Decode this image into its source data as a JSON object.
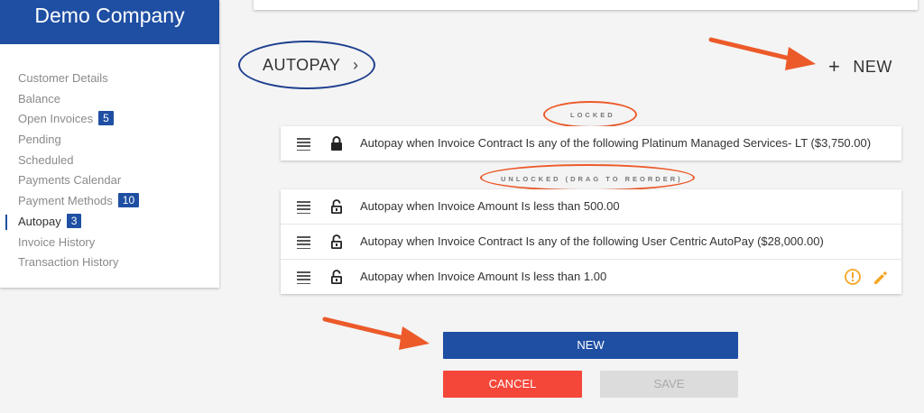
{
  "sidebar": {
    "company": "Demo Company",
    "items": [
      {
        "label": "Customer Details",
        "badge": null,
        "active": false
      },
      {
        "label": "Balance",
        "badge": null,
        "active": false
      },
      {
        "label": "Open Invoices",
        "badge": "5",
        "active": false
      },
      {
        "label": "Pending",
        "badge": null,
        "active": false
      },
      {
        "label": "Scheduled",
        "badge": null,
        "active": false
      },
      {
        "label": "Payments Calendar",
        "badge": null,
        "active": false
      },
      {
        "label": "Payment Methods",
        "badge": "10",
        "active": false
      },
      {
        "label": "Autopay",
        "badge": "3",
        "active": true
      },
      {
        "label": "Invoice History",
        "badge": null,
        "active": false
      },
      {
        "label": "Transaction History",
        "badge": null,
        "active": false
      }
    ]
  },
  "autopay": {
    "title": "AUTOPAY",
    "chevron": "›",
    "new_label": "NEW",
    "new_icon": "plus-icon",
    "locked_label": "LOCKED",
    "unlocked_label": "UNLOCKED (DRAG TO REORDER)",
    "locked_rules": [
      "Autopay when Invoice Contract Is any of the following Platinum Managed Services- LT ($3,750.00)"
    ],
    "unlocked_rules": [
      {
        "text": "Autopay when Invoice Amount Is less than 500.00",
        "actions": false
      },
      {
        "text": "Autopay when Invoice Contract Is any of the following User Centric AutoPay ($28,000.00)",
        "actions": false
      },
      {
        "text": "Autopay when Invoice Amount Is less than 1.00",
        "actions": true
      }
    ]
  },
  "buttons": {
    "new": "NEW",
    "cancel": "CANCEL",
    "save": "SAVE"
  },
  "colors": {
    "brand_blue": "#1f4fa3",
    "cancel_red": "#f4473a",
    "annotation_orange": "#ec5a2a",
    "annotation_blue": "#1f3f8f",
    "warning_amber": "#f5a623"
  }
}
